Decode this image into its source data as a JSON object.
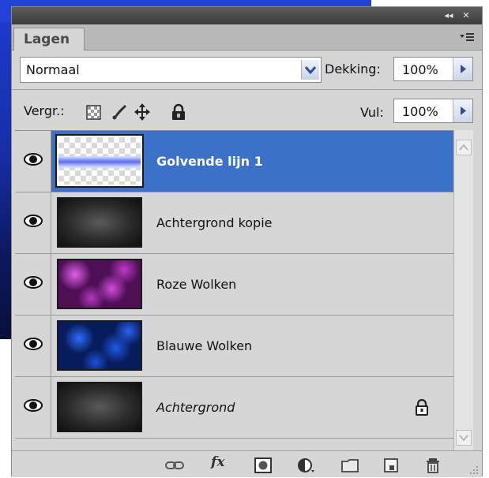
{
  "panel": {
    "tab_label": "Lagen",
    "title_buttons": [
      "collapse-icon",
      "close-icon"
    ],
    "colors": {
      "selection": "#3b72c8",
      "panel_bg": "#d6d6d6",
      "titlebar": "#4a4a4a"
    }
  },
  "blend": {
    "mode": "Normaal",
    "opacity_label": "Dekking:",
    "opacity_value": "100%"
  },
  "lock": {
    "label": "Vergr.:",
    "icons": [
      "lock-transparency-icon",
      "lock-image-icon",
      "lock-position-icon",
      "lock-all-icon"
    ],
    "fill_label": "Vul:",
    "fill_value": "100%"
  },
  "layers": [
    {
      "name": "Golvende lijn 1",
      "selected": true,
      "visible": true,
      "thumbnail": "wave-line-on-transparency"
    },
    {
      "name": "Achtergrond kopie",
      "selected": false,
      "visible": true,
      "thumbnail": "dark-radial-gradient"
    },
    {
      "name": "Roze Wolken",
      "selected": false,
      "visible": true,
      "thumbnail": "pink-clouds"
    },
    {
      "name": "Blauwe Wolken",
      "selected": false,
      "visible": true,
      "thumbnail": "blue-clouds"
    },
    {
      "name": "Achtergrond",
      "selected": false,
      "visible": true,
      "locked": true,
      "thumbnail": "dark-radial-gradient"
    }
  ],
  "bottom_icons": [
    "link-layers-icon",
    "fx-icon",
    "add-mask-icon",
    "adjustment-layer-icon",
    "new-group-icon",
    "new-layer-icon",
    "delete-layer-icon"
  ],
  "bottom": {
    "fx_label": "fx"
  }
}
